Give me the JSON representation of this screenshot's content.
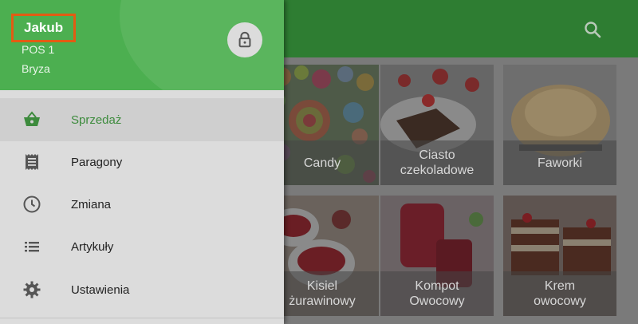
{
  "drawer": {
    "user_name": "Jakub",
    "terminal": "POS 1",
    "store": "Bryza",
    "menu": [
      {
        "label": "Sprzedaż",
        "icon": "basket-icon",
        "active": true
      },
      {
        "label": "Paragony",
        "icon": "receipt-icon",
        "active": false
      },
      {
        "label": "Zmiana",
        "icon": "clock-icon",
        "active": false
      },
      {
        "label": "Artykuły",
        "icon": "list-icon",
        "active": false
      },
      {
        "label": "Ustawienia",
        "icon": "gear-icon",
        "active": false
      }
    ]
  },
  "products": [
    {
      "label": "Candy"
    },
    {
      "label": "Ciasto\nczekoladowe"
    },
    {
      "label": "Faworki"
    },
    {
      "label": "Kisiel\nżurawinowy"
    },
    {
      "label": "Kompot\nOwocowy"
    },
    {
      "label": "Krem\nowocowy"
    }
  ],
  "colors": {
    "appbar": "#2e7d32",
    "drawer_header": "#4caf50",
    "active_text": "#3d8b3d",
    "highlight_border": "#e25c13"
  }
}
